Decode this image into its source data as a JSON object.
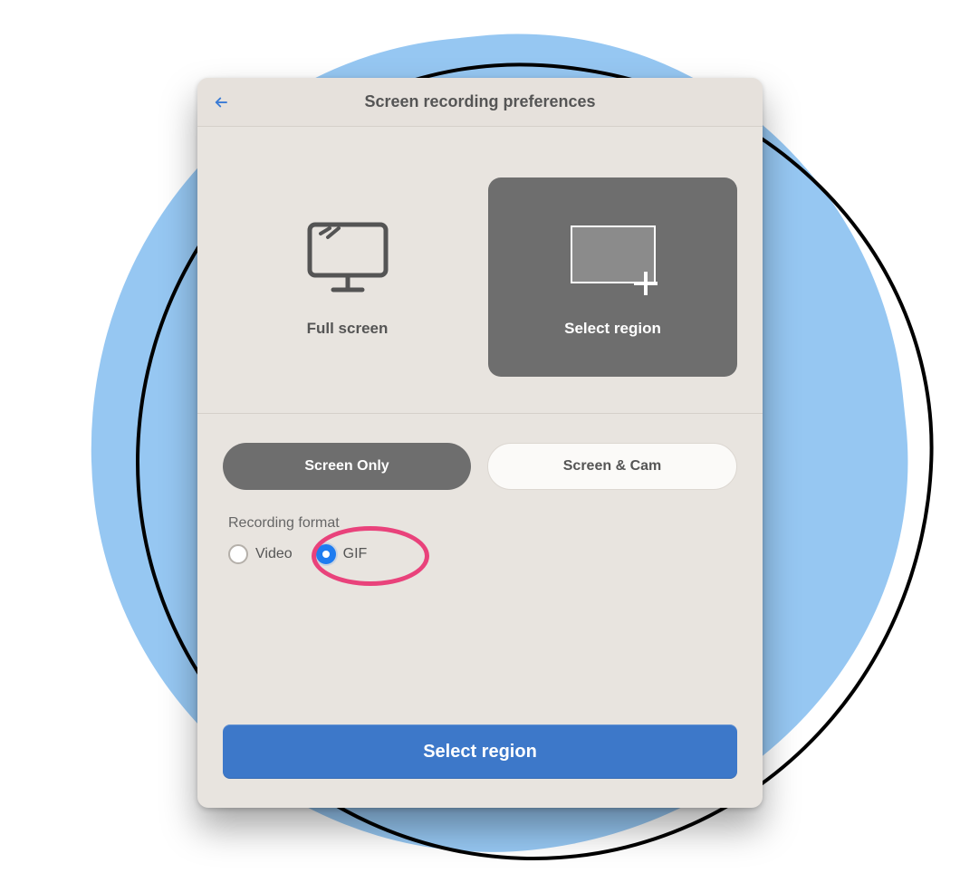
{
  "header": {
    "title": "Screen recording preferences"
  },
  "modes": {
    "full_screen": {
      "label": "Full screen",
      "selected": false
    },
    "select_region": {
      "label": "Select region",
      "selected": true
    }
  },
  "source": {
    "screen_only": {
      "label": "Screen Only",
      "selected": true
    },
    "screen_and_cam": {
      "label": "Screen & Cam",
      "selected": false
    }
  },
  "format": {
    "section_label": "Recording format",
    "options": {
      "video": {
        "label": "Video",
        "selected": false
      },
      "gif": {
        "label": "GIF",
        "selected": true
      }
    }
  },
  "action": {
    "primary_label": "Select region"
  },
  "icons": {
    "back": "arrow-left",
    "monitor": "monitor",
    "region": "crop-region"
  }
}
